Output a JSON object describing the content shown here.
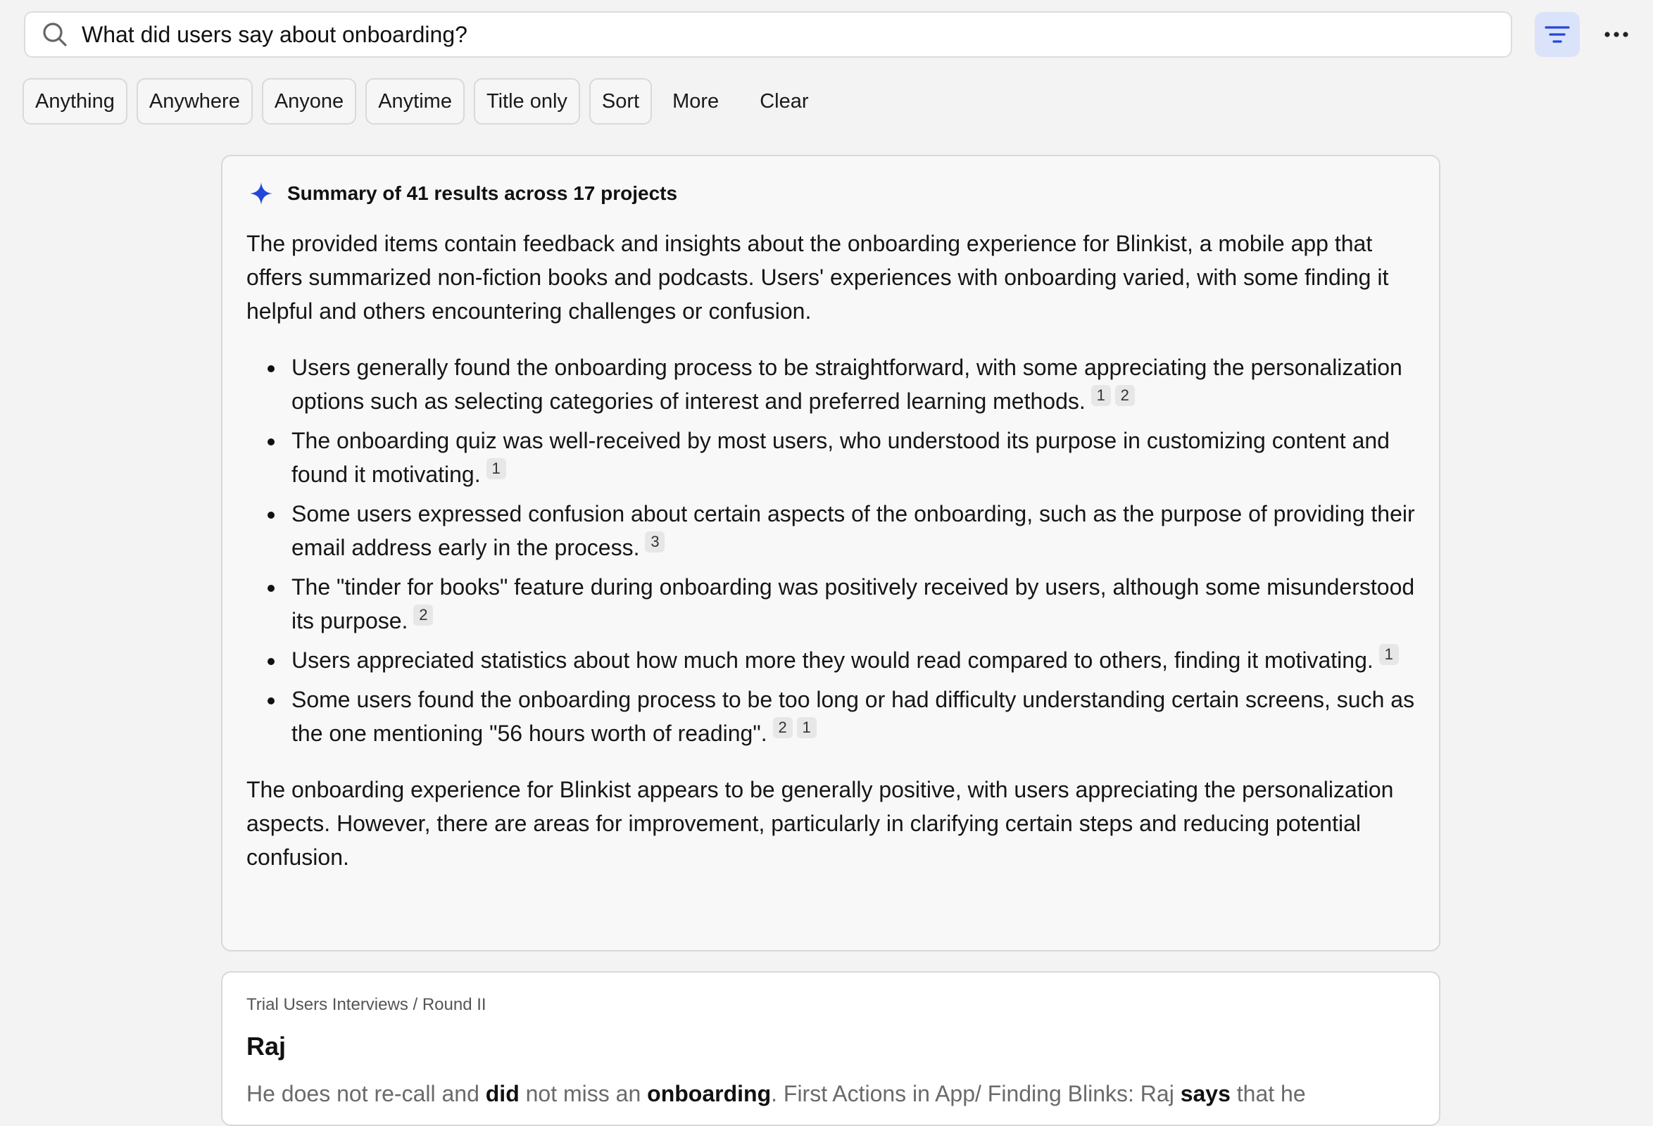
{
  "search": {
    "query": "What did users say about onboarding?"
  },
  "icons": {
    "search": "search-icon",
    "filter": "filter-lines-icon",
    "more": "ellipsis-icon",
    "sparkle": "sparkle-icon"
  },
  "colors": {
    "accent": "#2446d8",
    "filter_button_bg": "#dbe3fb"
  },
  "filters": {
    "chips": [
      "Anything",
      "Anywhere",
      "Anyone",
      "Anytime",
      "Title only",
      "Sort"
    ],
    "more_label": "More",
    "clear_label": "Clear"
  },
  "summary": {
    "title": "Summary of 41 results across 17 projects",
    "intro": "The provided items contain feedback and insights about the onboarding experience for Blinkist, a mobile app that offers summarized non-fiction books and podcasts. Users' experiences with onboarding varied, with some finding it helpful and others encountering challenges or confusion.",
    "bullets": [
      {
        "text": "Users generally found the onboarding process to be straightforward, with some appreciating the personalization options such as selecting categories of interest and preferred learning methods.",
        "citations": [
          "1",
          "2"
        ]
      },
      {
        "text": "The onboarding quiz was well-received by most users, who understood its purpose in customizing content and found it motivating.",
        "citations": [
          "1"
        ]
      },
      {
        "text": "Some users expressed confusion about certain aspects of the onboarding, such as the purpose of providing their email address early in the process.",
        "citations": [
          "3"
        ]
      },
      {
        "text": "The \"tinder for books\" feature during onboarding was positively received by users, although some misunderstood its purpose.",
        "citations": [
          "2"
        ]
      },
      {
        "text": "Users appreciated statistics about how much more they would read compared to others, finding it motivating.",
        "citations": [
          "1"
        ]
      },
      {
        "text": "Some users found the onboarding process to be too long or had difficulty understanding certain screens, such as the one mentioning \"56 hours worth of reading\".",
        "citations": [
          "2",
          "1"
        ]
      }
    ],
    "conclusion": "The onboarding experience for Blinkist appears to be generally positive, with users appreciating the personalization aspects. However, there are areas for improvement, particularly in clarifying certain steps and reducing potential confusion."
  },
  "result": {
    "breadcrumb": "Trial Users Interviews / Round II",
    "title": "Raj",
    "snippet": [
      {
        "text": "He does not re-call and ",
        "bold": false
      },
      {
        "text": "did",
        "bold": true
      },
      {
        "text": " not miss an ",
        "bold": false
      },
      {
        "text": "onboarding",
        "bold": true
      },
      {
        "text": ". First Actions in App/ Finding Blinks:  Raj ",
        "bold": false
      },
      {
        "text": "says",
        "bold": true
      },
      {
        "text": " that he",
        "bold": false
      }
    ]
  }
}
